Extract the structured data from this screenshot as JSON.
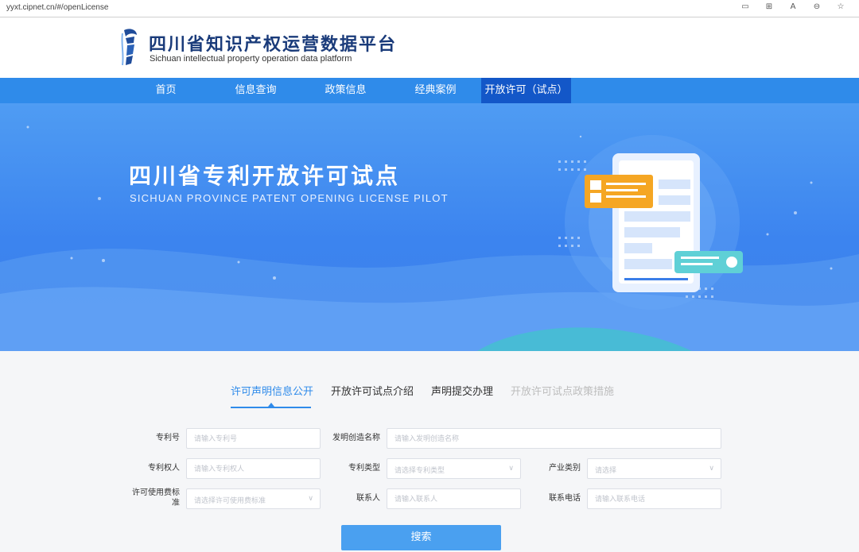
{
  "browser": {
    "url": "yyxt.cipnet.cn/#/openLicense",
    "tool_icons": [
      "reader-icon",
      "grid-icon",
      "read-aloud-icon",
      "zoom-icon",
      "favorite-icon"
    ],
    "tool_glyphs": [
      "▭",
      "⊞",
      "A",
      "⊖",
      "☆"
    ]
  },
  "header": {
    "title_cn": "四川省知识产权运营数据平台",
    "title_en": "Sichuan intellectual property operation data platform"
  },
  "nav": {
    "items": [
      "首页",
      "信息查询",
      "政策信息",
      "经典案例",
      "开放许可（试点）"
    ],
    "active_index": 4
  },
  "banner": {
    "title_cn": "四川省专利开放许可试点",
    "title_en": "SICHUAN PROVINCE PATENT OPENING LICENSE PILOT"
  },
  "tabs": {
    "items": [
      "许可声明信息公开",
      "开放许可试点介绍",
      "声明提交办理",
      "开放许可试点政策措施"
    ],
    "active_index": 0,
    "disabled_index": 3
  },
  "form": {
    "patent_no": {
      "label": "专利号",
      "placeholder": "请输入专利号"
    },
    "invention_name": {
      "label": "发明创造名称",
      "placeholder": "请输入发明创造名称"
    },
    "patentee": {
      "label": "专利权人",
      "placeholder": "请输入专利权人"
    },
    "patent_type": {
      "label": "专利类型",
      "placeholder": "请选择专利类型"
    },
    "industry": {
      "label": "产业类别",
      "placeholder": "请选择"
    },
    "fee_standard": {
      "label": "许可使用费标准",
      "placeholder": "请选择许可使用费标准"
    },
    "contact": {
      "label": "联系人",
      "placeholder": "请输入联系人"
    },
    "phone": {
      "label": "联系电话",
      "placeholder": "请输入联系电话"
    },
    "search_label": "搜索"
  },
  "colors": {
    "nav_bg": "#2f8bea",
    "nav_active": "#1357c8",
    "accent": "#2f8bea",
    "search_btn": "#4aa0f0"
  }
}
